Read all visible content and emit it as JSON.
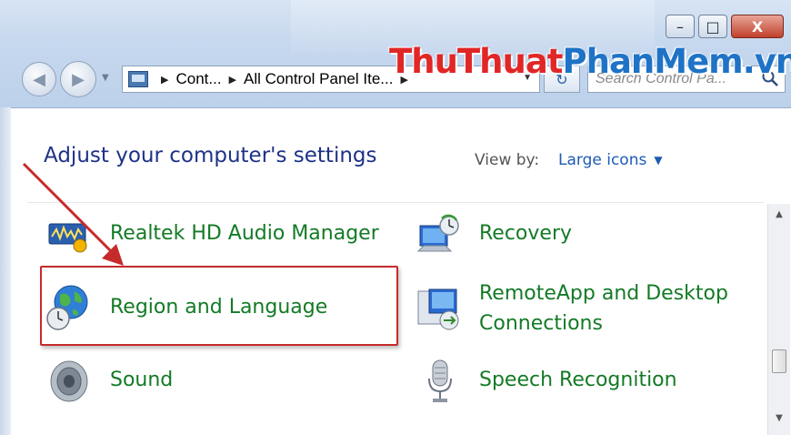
{
  "window": {
    "minimize_glyph": "–",
    "maximize_glyph": "□",
    "close_glyph": "X"
  },
  "watermark": {
    "part1": "ThuThuat",
    "part2": "PhanMem.vn"
  },
  "address_bar": {
    "crumbs": [
      "Cont...",
      "All Control Panel Ite..."
    ]
  },
  "search": {
    "placeholder": "Search Control Pa..."
  },
  "content": {
    "heading": "Adjust your computer's settings",
    "view_by_label": "View by:",
    "view_by_value": "Large icons"
  },
  "items": [
    {
      "label": "Realtek HD Audio Manager",
      "icon": "realtek-audio-icon"
    },
    {
      "label": "Recovery",
      "icon": "recovery-icon"
    },
    {
      "label": "Region and Language",
      "icon": "region-language-icon"
    },
    {
      "label": "RemoteApp and Desktop",
      "label2": "Connections",
      "icon": "remoteapp-icon"
    },
    {
      "label": "Sound",
      "icon": "sound-icon"
    },
    {
      "label": "Speech Recognition",
      "icon": "speech-recognition-icon"
    }
  ],
  "colors": {
    "link_green": "#147a26",
    "heading_blue": "#1e3287",
    "annotation_red": "#c62b2b"
  }
}
